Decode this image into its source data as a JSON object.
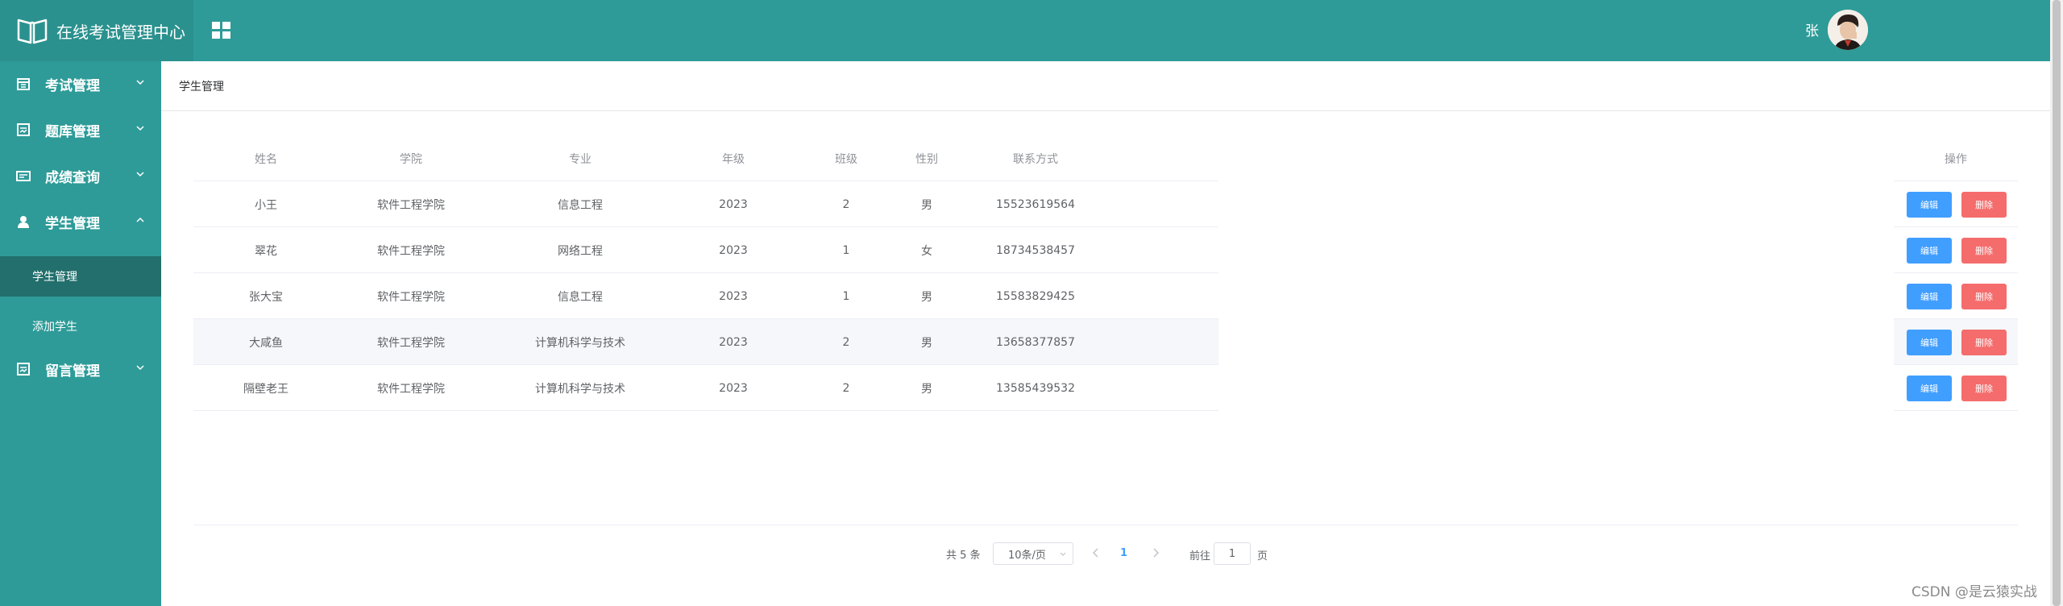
{
  "header": {
    "title": "在线考试管理中心",
    "user_name": "张",
    "colors": {
      "bar": "#2e9b98",
      "brand": "#2b918e"
    },
    "icons": {
      "logo": "book-icon",
      "grid": "grid-icon"
    }
  },
  "sidebar": {
    "items": [
      {
        "label": "考试管理",
        "icon": "calendar-icon",
        "expanded": false
      },
      {
        "label": "题库管理",
        "icon": "document-icon",
        "expanded": false
      },
      {
        "label": "成绩查询",
        "icon": "card-icon",
        "expanded": false
      },
      {
        "label": "学生管理",
        "icon": "user-icon",
        "expanded": true
      },
      {
        "label": "留言管理",
        "icon": "note-icon",
        "expanded": false
      }
    ],
    "sub_items": [
      {
        "label": "学生管理",
        "active": true
      },
      {
        "label": "添加学生",
        "active": false
      }
    ]
  },
  "breadcrumb": "学生管理",
  "table": {
    "headers": [
      "姓名",
      "学院",
      "专业",
      "年级",
      "班级",
      "性别",
      "联系方式",
      "操作"
    ],
    "rows": [
      [
        "小王",
        "软件工程学院",
        "信息工程",
        "2023",
        "2",
        "男",
        "15523619564"
      ],
      [
        "翠花",
        "软件工程学院",
        "网络工程",
        "2023",
        "1",
        "女",
        "18734538457"
      ],
      [
        "张大宝",
        "软件工程学院",
        "信息工程",
        "2023",
        "1",
        "男",
        "15583829425"
      ],
      [
        "大咸鱼",
        "软件工程学院",
        "计算机科学与技术",
        "2023",
        "2",
        "男",
        "13658377857"
      ],
      [
        "隔壁老王",
        "软件工程学院",
        "计算机科学与技术",
        "2023",
        "2",
        "男",
        "13585439532"
      ]
    ],
    "edit_label": "编辑",
    "delete_label": "删除",
    "hovered_row": 3
  },
  "pagination": {
    "total_text": "共 5 条",
    "page_size": "10条/页",
    "current_page": "1",
    "goto_label": "前往",
    "goto_value": "1",
    "page_suffix": "页"
  },
  "watermark": "CSDN @是云猿实战"
}
